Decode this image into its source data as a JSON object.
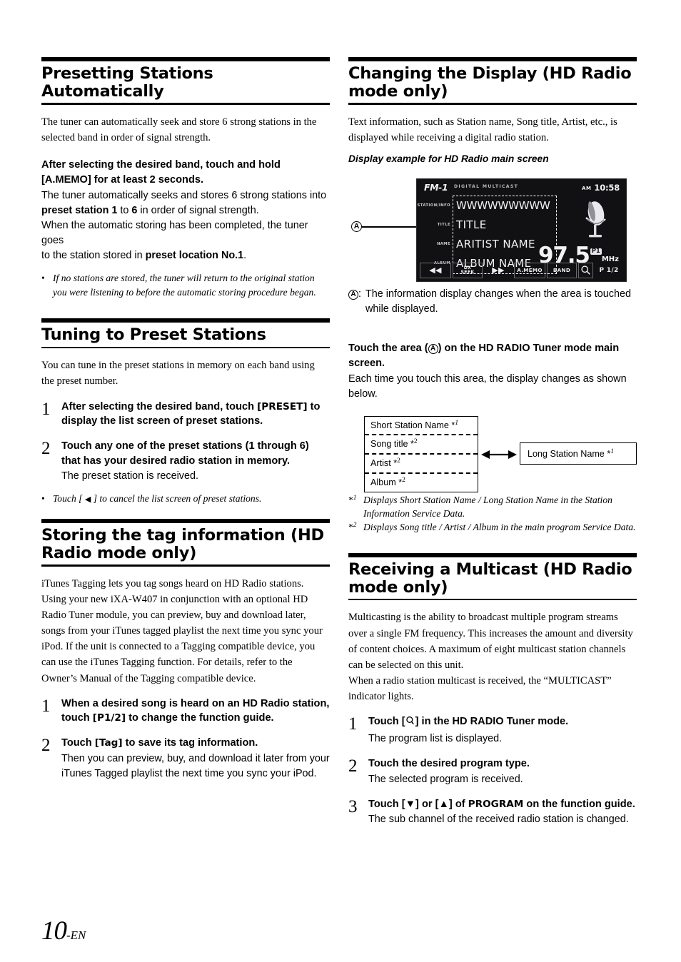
{
  "page": {
    "number_label": "10",
    "suffix": "-EN"
  },
  "left_column": {
    "section1": {
      "title": "Presetting Stations Automatically",
      "intro": "The tuner can automatically seek and store 6 strong stations in the selected band in order of signal strength.",
      "bold_head_1": "After selecting the desired band, touch and hold",
      "bold_head_2": "[A.MEMO] for at least 2 seconds.",
      "body_a": "The tuner automatically seeks and stores 6 strong stations into",
      "body_b_pre": "preset station 1",
      "body_b_mid": " to ",
      "body_b_num": "6",
      "body_b_post": " in order of signal strength.",
      "body_c": "When the automatic storing has been completed, the tuner goes",
      "body_d_pre": "to the station stored in ",
      "body_d_bold": "preset location No.1",
      "body_d_post": ".",
      "note_bullet": "•",
      "note_text": "If no stations are stored, the tuner will return to the original station you were listening to before the automatic storing procedure began."
    },
    "section2": {
      "title": "Tuning to Preset Stations",
      "intro": "You can tune in the preset stations in memory on each band using the preset number.",
      "steps": [
        {
          "num": "1",
          "head_a": "After selecting the desired band, touch ",
          "head_kbd": "[PRESET]",
          "head_b": " to display the list screen of preset stations.",
          "body": ""
        },
        {
          "num": "2",
          "head_a": "Touch any one of the preset stations (1 through 6) that has your desired radio station in memory.",
          "head_kbd": "",
          "head_b": "",
          "body": "The preset station is received."
        }
      ],
      "note_bullet": "•",
      "note_text_a": "Touch [ ",
      "note_glyph": "◀",
      "note_text_b": " ] to cancel the list screen of preset stations."
    },
    "section3": {
      "title": "Storing the tag information (HD Radio mode only)",
      "intro": "iTunes Tagging lets you tag songs heard on HD Radio stations. Using your new iXA-W407 in conjunction with an optional HD Radio Tuner module, you can preview, buy and download later, songs from your iTunes tagged playlist the next time you sync your iPod. If the unit is connected to a Tagging compatible device, you can use the iTunes Tagging function. For details, refer to the Owner’s Manual of the Tagging compatible device.",
      "steps": [
        {
          "num": "1",
          "head_a": "When a desired song is heard on an HD Radio station, touch ",
          "head_kbd": "[P1/2]",
          "head_b": " to change the function guide.",
          "body": ""
        },
        {
          "num": "2",
          "head_a": "Touch ",
          "head_kbd": "[Tag]",
          "head_b": " to save its tag information.",
          "body": "Then you can preview, buy, and download it later from your iTunes Tagged playlist the next time you sync your iPod."
        }
      ]
    }
  },
  "right_column": {
    "section4": {
      "title": "Changing the Display (HD Radio mode only)",
      "intro": "Text information, such as Station name, Song title, Artist, etc., is displayed while receiving a digital radio station.",
      "caption": "Display example for HD Radio main screen",
      "screen": {
        "callout_label": "A",
        "band": "FM-1",
        "tags": "DIGITAL MULTICAST",
        "clock_ampm": "AM",
        "clock_time": "10:58",
        "row_labels": [
          {
            "line1": "STATION/",
            "line2": "INFO"
          },
          {
            "line1": "TITLE",
            "line2": ""
          },
          {
            "line1": "NAME",
            "line2": ""
          },
          {
            "line1": "ALBUM",
            "line2": ""
          }
        ],
        "rows": [
          "WWWWWWWWW",
          "TITLE",
          "ARITIST  NAME",
          "ALBUM  NAME"
        ],
        "frequency": "97.5",
        "freq_unit": "MHz",
        "preset_badge": "P1",
        "function_guide": [
          {
            "name": "prev-track",
            "label": "◀◀"
          },
          {
            "name": "dx-seek",
            "label": "DX\nSEEK"
          },
          {
            "name": "next-track",
            "label": "▶▶"
          },
          {
            "name": "a-memo",
            "label": "A.MEMO"
          },
          {
            "name": "band",
            "label": "BAND"
          },
          {
            "name": "search",
            "label": "search-icon"
          },
          {
            "name": "page-1-2",
            "label": "P 1/2"
          }
        ]
      },
      "callout_note_label": "A",
      "callout_note_colon": ":",
      "callout_note_text": "The information display changes when the area is touched while displayed.",
      "touch_head_a": "Touch the area (",
      "touch_head_circle": "A",
      "touch_head_b": ") on the HD RADIO Tuner mode main screen.",
      "touch_body": "Each time you touch this area, the display changes as shown below.",
      "diagram": {
        "left_box": [
          {
            "text": "Short Station Name ",
            "mark": "*",
            "sup": "1"
          },
          {
            "text": "Song title ",
            "mark": "*",
            "sup": "2"
          },
          {
            "text": "Artist ",
            "mark": "*",
            "sup": "2"
          },
          {
            "text": "Album ",
            "mark": "*",
            "sup": "2"
          }
        ],
        "right_box": {
          "text": "Long Station Name ",
          "mark": "*",
          "sup": "1"
        },
        "arrow": "↔"
      },
      "footnotes": [
        {
          "mark": "*",
          "sup": "1",
          "text": "Displays Short Station Name / Long Station Name in the Station Information Service Data."
        },
        {
          "mark": "*",
          "sup": "2",
          "text": "Displays Song title / Artist / Album in the main program Service Data."
        }
      ]
    },
    "section5": {
      "title": "Receiving a Multicast (HD Radio mode only)",
      "intro_a": "Multicasting is the ability to broadcast multiple program streams over a single FM frequency. This increases the amount and diversity of content choices. A maximum of eight multicast station channels can be selected on this unit.",
      "intro_b": "When a radio station multicast is received, the “MULTICAST” indicator lights.",
      "steps": [
        {
          "num": "1",
          "head_a": "Touch [",
          "head_kbd": "search-icon",
          "head_b": "] in the HD RADIO Tuner mode.",
          "body": "The program list is displayed."
        },
        {
          "num": "2",
          "head_a": "Touch the desired program type.",
          "head_kbd": "",
          "head_b": "",
          "body": "The selected program is received."
        },
        {
          "num": "3",
          "head_a": "Touch [▼] or [▲] of ",
          "head_kbd": "PROGRAM",
          "head_b": " on the function guide.",
          "body": "The sub channel of the received radio station is changed."
        }
      ]
    }
  },
  "colors": {
    "ink": "#000000",
    "paper": "#ffffff",
    "screen_bg": "#111114"
  }
}
